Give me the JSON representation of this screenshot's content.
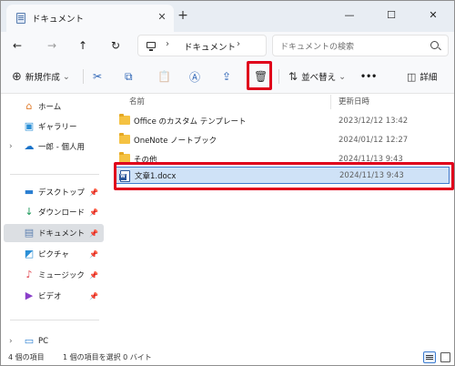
{
  "tab": {
    "title": "ドキュメント",
    "close": "✕",
    "new": "+"
  },
  "window_controls": {
    "minimize": "—",
    "maximize": "☐",
    "close": "✕"
  },
  "address": {
    "nav_back": "←",
    "nav_forward": "→",
    "nav_up": "↑",
    "refresh": "↻",
    "chevron": "›",
    "path": "ドキュメント",
    "search_placeholder": "ドキュメントの検索"
  },
  "commandbar": {
    "new_label": "新規作成",
    "sort_label": "並べ替え",
    "more": "•••",
    "details_label": "詳細",
    "dropdown": "⌄"
  },
  "sidebar": {
    "top": [
      {
        "label": "ホーム",
        "icon": "home-icon"
      },
      {
        "label": "ギャラリー",
        "icon": "gallery-icon"
      },
      {
        "label": "一郎 - 個人用",
        "icon": "onedrive-icon",
        "expander": "›"
      }
    ],
    "quick": [
      {
        "label": "デスクトップ",
        "icon": "desktop-icon",
        "pin": "📌"
      },
      {
        "label": "ダウンロード",
        "icon": "download-icon",
        "pin": "📌"
      },
      {
        "label": "ドキュメント",
        "icon": "documents-icon",
        "pin": "📌",
        "active": true
      },
      {
        "label": "ピクチャ",
        "icon": "pictures-icon",
        "pin": "📌"
      },
      {
        "label": "ミュージック",
        "icon": "music-icon",
        "pin": "📌"
      },
      {
        "label": "ビデオ",
        "icon": "videos-icon",
        "pin": "📌"
      }
    ],
    "bottom": [
      {
        "label": "PC",
        "icon": "pc-icon",
        "expander": "›"
      }
    ]
  },
  "file_list": {
    "columns": {
      "name": "名前",
      "modified": "更新日時"
    },
    "rows": [
      {
        "name": "Office のカスタム テンプレート",
        "modified": "2023/12/12 13:42",
        "type": "folder"
      },
      {
        "name": "OneNote ノートブック",
        "modified": "2024/01/12 12:27",
        "type": "folder"
      },
      {
        "name": "その他",
        "modified": "2024/11/13 9:43",
        "type": "folder"
      },
      {
        "name": "文章1.docx",
        "modified": "2024/11/13 9:43",
        "type": "word",
        "selected": true
      }
    ]
  },
  "status": {
    "items_count": "4 個の項目",
    "selection": "1 個の項目を選択  0 バイト"
  },
  "colors": {
    "accent": "#2b63b5",
    "highlight_red": "#e0001b",
    "selection_bg": "#cfe2f7",
    "folder": "#f5c242"
  }
}
